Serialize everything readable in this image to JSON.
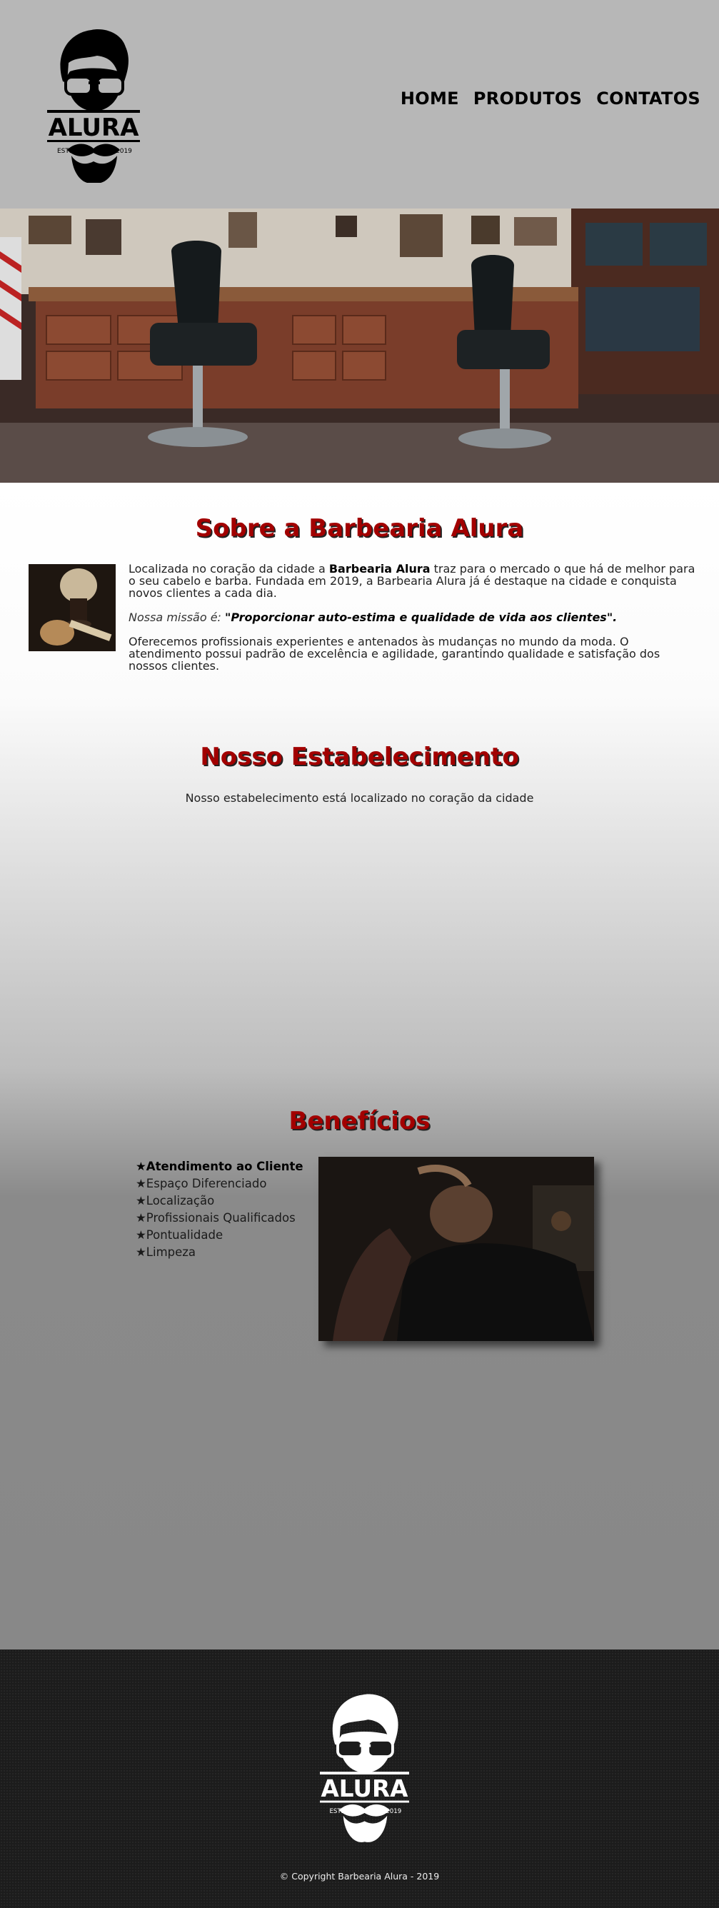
{
  "header": {
    "logo_text": "ALURA",
    "logo_estd": "ESTD",
    "logo_year": "2019",
    "nav": [
      "HOME",
      "PRODUTOS",
      "CONTATOS"
    ]
  },
  "about": {
    "title": "Sobre a Barbearia Alura",
    "p1_pre": "Localizada no coração da cidade a ",
    "p1_bold": "Barbearia Alura",
    "p1_post": " traz para o mercado o que há de melhor para o seu cabelo e barba. Fundada em 2019, a Barbearia Alura já é destaque na cidade e conquista novos clientes a cada dia.",
    "mission_label": "Nossa missão é:",
    "mission_quote": "\"Proporcionar auto-estima e qualidade de vida aos clientes\".",
    "p3": "Oferecemos profissionais experientes e antenados às mudanças no mundo da moda. O atendimento possui padrão de excelência e agilidade, garantindo qualidade e satisfação dos nossos clientes."
  },
  "establishment": {
    "title": "Nosso Estabelecimento",
    "subtitle": "Nosso estabelecimento está localizado no coração da cidade"
  },
  "benefits": {
    "title": "Benefícios",
    "bullet": "★",
    "items": [
      "Atendimento ao Cliente",
      "Espaço Diferenciado",
      "Localização",
      "Profissionais Qualificados",
      "Pontualidade",
      "Limpeza"
    ]
  },
  "footer": {
    "logo_text": "ALURA",
    "logo_estd": "ESTD",
    "logo_year": "2019",
    "copyright": "© Copyright Barbearia Alura - 2019"
  },
  "colors": {
    "header_bg": "#b7b7b7",
    "title_red": "#a20000",
    "footer_bg": "#1c1c1c"
  }
}
